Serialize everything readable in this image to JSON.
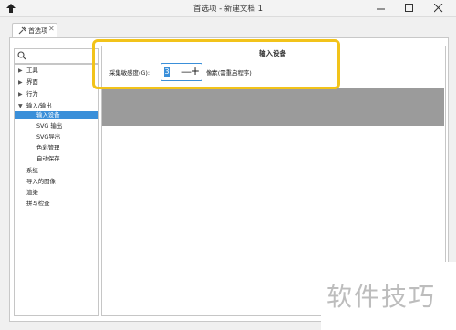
{
  "window": {
    "title": "首选项 - 新建文档 1"
  },
  "tab": {
    "label": "首选项",
    "close": "✕"
  },
  "sidebar": {
    "items": [
      {
        "label": "工具",
        "arrow": "▶",
        "indent": 0
      },
      {
        "label": "界面",
        "arrow": "▶",
        "indent": 0
      },
      {
        "label": "行为",
        "arrow": "▶",
        "indent": 0
      },
      {
        "label": "输入/输出",
        "arrow": "▼",
        "indent": 0
      },
      {
        "label": "输入设备",
        "arrow": "",
        "indent": 1,
        "selected": true
      },
      {
        "label": "SVG 输出",
        "arrow": "",
        "indent": 1
      },
      {
        "label": "SVG导出",
        "arrow": "",
        "indent": 1
      },
      {
        "label": "色彩管理",
        "arrow": "",
        "indent": 1
      },
      {
        "label": "自动保存",
        "arrow": "",
        "indent": 1
      },
      {
        "label": "系统",
        "arrow": "",
        "indent": 0
      },
      {
        "label": "导入的图像",
        "arrow": "",
        "indent": 0
      },
      {
        "label": "渲染",
        "arrow": "",
        "indent": 0
      },
      {
        "label": "拼写检查",
        "arrow": "",
        "indent": 0
      }
    ]
  },
  "content": {
    "section_title": "输入设备",
    "grab_label": "采集敏感度(G):",
    "grab_value": "3",
    "grab_unit": "像素(需重启程序)",
    "minus": "—",
    "plus": "+"
  },
  "colors": {
    "highlight": "#f2c31a",
    "selection": "#3a8fd9"
  },
  "watermark": "软件技巧"
}
